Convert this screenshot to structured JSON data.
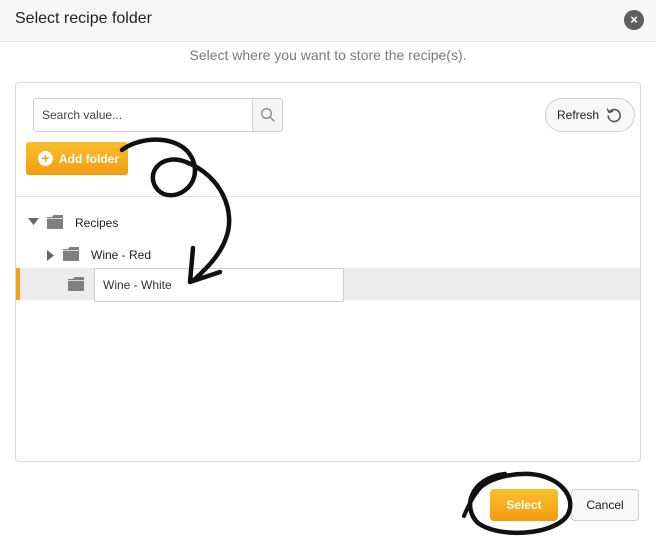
{
  "dialog": {
    "title": "Select recipe folder",
    "close_symbol": "×",
    "subtitle": "Select where you want to store the recipe(s)."
  },
  "toolbar": {
    "search_placeholder": "Search value...",
    "search_icon": "magnifier-icon",
    "refresh_label": "Refresh",
    "refresh_icon": "refresh-icon",
    "add_folder_label": "Add folder",
    "add_folder_icon": "plus-circle-icon"
  },
  "tree": {
    "root": {
      "label": "Recipes",
      "expanded": true
    },
    "children": [
      {
        "label": "Wine - Red",
        "expanded": false
      },
      {
        "label": "Wine - White",
        "editing": true,
        "selected": true
      }
    ]
  },
  "footer": {
    "select_label": "Select",
    "cancel_label": "Cancel"
  },
  "colors": {
    "accent": "#f3a318",
    "accent_light": "#fbbf2e",
    "folder": "#7f7f7f",
    "selected_row": "#ececec"
  }
}
